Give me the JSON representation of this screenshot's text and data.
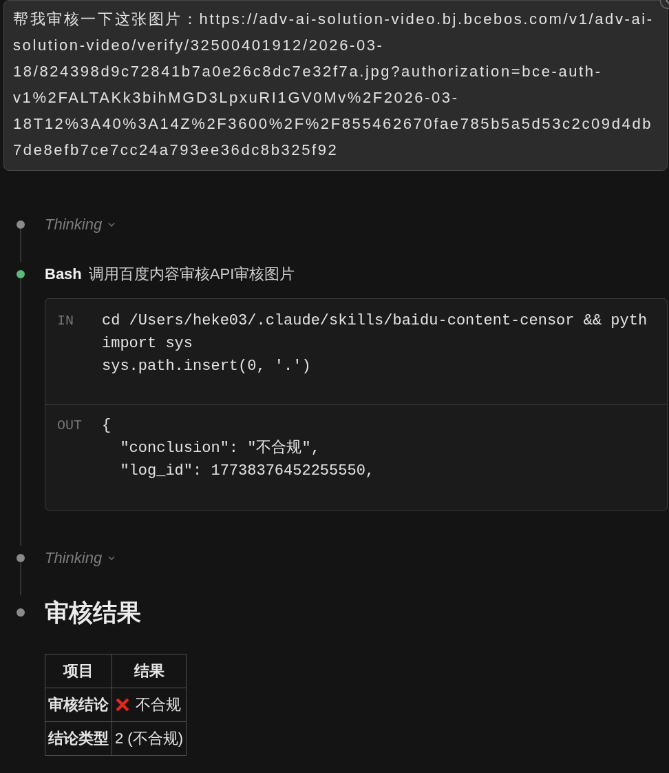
{
  "message": {
    "text": "帮我审核一下这张图片：https://adv-ai-solution-video.bj.bcebos.com/v1/adv-ai-solution-video/verify/32500401912/2026-03-18/824398d9c72841b7a0e26c8dc7e32f7a.jpg?authorization=bce-auth-v1%2FALTAKk3bihMGD3LpxuRI1GV0Mv%2F2026-03-18T12%3A40%3A14Z%2F3600%2F%2F855462670fae785b5a5d53c2c09d4db7de8efb7ce7cc24a793ee36dc8b325f92"
  },
  "timeline": [
    {
      "kind": "thinking",
      "label": "Thinking",
      "color": "#8a8a8a"
    },
    {
      "kind": "tool",
      "tool": "Bash",
      "description": "调用百度内容审核API审核图片",
      "color": "#5cb97a",
      "input_label": "IN",
      "input_lines": [
        "cd /Users/heke03/.claude/skills/baidu-content-censor && pyth",
        "import sys",
        "sys.path.insert(0, '.')"
      ],
      "output_label": "OUT",
      "output_lines": [
        "{",
        "  \"conclusion\": \"不合规\",",
        "  \"log_id\": 17738376452255550,"
      ]
    },
    {
      "kind": "thinking",
      "label": "Thinking",
      "color": "#8a8a8a"
    },
    {
      "kind": "result",
      "heading": "审核结果",
      "color": "#8a8a8a",
      "table": {
        "columns": [
          "项目",
          "结果"
        ],
        "rows": [
          {
            "item": "审核结论",
            "result": "不合规",
            "failed": true
          },
          {
            "item": "结论类型",
            "result": "2 (不合规)",
            "failed": false
          }
        ]
      }
    }
  ]
}
